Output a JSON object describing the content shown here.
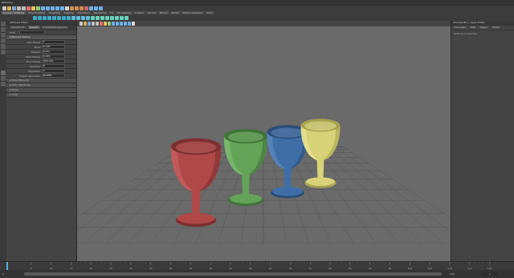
{
  "app": {
    "title": "Modeling"
  },
  "status_line": {
    "workspace": "Modeling",
    "tools": [
      {
        "icon": "new-scene-icon",
        "color": "#c9c9c9"
      },
      {
        "icon": "open-scene-icon",
        "color": "#d9b24c"
      },
      {
        "icon": "save-scene-icon",
        "color": "#7aa6d6"
      },
      {
        "icon": "undo-icon",
        "color": "#bdbdbd"
      },
      {
        "icon": "redo-icon",
        "color": "#bdbdbd"
      },
      {
        "icon": "select-hierarchy-icon",
        "color": "#ef6f6f"
      },
      {
        "icon": "select-object-icon",
        "color": "#e7c45a"
      },
      {
        "icon": "select-component-icon",
        "color": "#8fd17a"
      },
      {
        "icon": "snap-grid-icon",
        "color": "#6fb0e8"
      },
      {
        "icon": "snap-curve-icon",
        "color": "#6fb0e8"
      },
      {
        "icon": "snap-point-icon",
        "color": "#6fb0e8"
      },
      {
        "icon": "snap-view-icon",
        "color": "#6fb0e8"
      },
      {
        "icon": "snap-surface-icon",
        "color": "#6fb0e8"
      },
      {
        "icon": "construction-history-icon",
        "color": "#d9d9d9"
      },
      {
        "icon": "render-frame-icon",
        "color": "#d38f4f"
      },
      {
        "icon": "ipr-render-icon",
        "color": "#d38f4f"
      },
      {
        "icon": "render-settings-icon",
        "color": "#d38f4f"
      },
      {
        "icon": "hypershade-icon",
        "color": "#cf6b6b"
      },
      {
        "icon": "toggle-modeling-toolkit-icon",
        "color": "#6fb0e8"
      },
      {
        "icon": "toggle-attribute-editor-icon",
        "color": "#6fb0e8"
      },
      {
        "icon": "toggle-channel-box-icon",
        "color": "#6fb0e8"
      }
    ]
  },
  "shelf": {
    "tabs": [
      "Curves / Surfaces",
      "Poly Modeling",
      "Sculpting",
      "Rigging",
      "Animation",
      "Rendering",
      "FX",
      "FX Caching",
      "Custom",
      "Arnold",
      "Bifrost",
      "MASH",
      "Motion Graphics",
      "XGen"
    ],
    "active_tab": 0,
    "tools": [
      {
        "icon": "nurbs-sphere-icon",
        "color": "#3fa9c9"
      },
      {
        "icon": "nurbs-cube-icon",
        "color": "#3fa9c9"
      },
      {
        "icon": "nurbs-cylinder-icon",
        "color": "#3fa9c9"
      },
      {
        "icon": "nurbs-cone-icon",
        "color": "#3fa9c9"
      },
      {
        "icon": "nurbs-plane-icon",
        "color": "#3fa9c9"
      },
      {
        "icon": "nurbs-torus-icon",
        "color": "#3fa9c9"
      },
      {
        "icon": "nurbs-circle-icon",
        "color": "#3fa9c9"
      },
      {
        "icon": "nurbs-square-icon",
        "color": "#3fa9c9"
      },
      {
        "icon": "cv-curve-icon",
        "color": "#5fc0dc"
      },
      {
        "icon": "ep-curve-icon",
        "color": "#5fc0dc"
      },
      {
        "icon": "pencil-curve-icon",
        "color": "#5fc0dc"
      },
      {
        "icon": "arc-tool-icon",
        "color": "#5fc0dc"
      },
      {
        "icon": "revolve-icon",
        "color": "#6ad1b9"
      },
      {
        "icon": "loft-icon",
        "color": "#6ad1b9"
      },
      {
        "icon": "planar-icon",
        "color": "#6ad1b9"
      },
      {
        "icon": "extrude-icon",
        "color": "#6ad1b9"
      },
      {
        "icon": "birail-icon",
        "color": "#6ad1b9"
      },
      {
        "icon": "boundary-icon",
        "color": "#6ad1b9"
      },
      {
        "icon": "bevel-plus-icon",
        "color": "#6ad1b9"
      },
      {
        "icon": "offset-curve-icon",
        "color": "#6ad1b9"
      }
    ]
  },
  "attribute_editor": {
    "header": "Attribute Editor",
    "node_label": "bowl",
    "tabs": [
      "transform1",
      "shape1",
      "initialShadingGroup"
    ],
    "section": "Revolve History",
    "rows": [
      {
        "label": "Axis Preset",
        "value": "Y"
      },
      {
        "label": "Pivot",
        "value": "0.000"
      },
      {
        "label": "Degree",
        "value": "Cubic"
      },
      {
        "label": "Start Sweep",
        "value": "0.000"
      },
      {
        "label": "End Sweep",
        "value": "360.000"
      },
      {
        "label": "Sections",
        "value": "8"
      },
      {
        "label": "Segments",
        "value": "1"
      },
      {
        "label": "Output geometry",
        "value": "NURBS"
      }
    ],
    "collapsed_sections": [
      "Node Behavior",
      "Extra Attributes",
      "Notes",
      "UUID"
    ]
  },
  "viewport": {
    "background": "#6a6a6a",
    "grid_color": "#575757",
    "objects": [
      {
        "name": "red-goblet",
        "color": "#b04848",
        "shade": "#7e2f2f",
        "light": "#d06a6a"
      },
      {
        "name": "green-goblet",
        "color": "#63a458",
        "shade": "#3f7337",
        "light": "#88c47c"
      },
      {
        "name": "blue-goblet",
        "color": "#3f6ea7",
        "shade": "#2a4c78",
        "light": "#6692c6"
      },
      {
        "name": "yellow-goblet",
        "color": "#d8d378",
        "shade": "#a8a24f",
        "light": "#eeea9e"
      }
    ]
  },
  "right_panel": {
    "title": "Channel Box / Layer Editor",
    "menu": [
      "Channels",
      "Edit",
      "Object",
      "Show"
    ],
    "note": "Nothing is selected"
  },
  "timeline": {
    "start": "1",
    "end": "120",
    "current_frame": "1",
    "ticks": [
      "5",
      "10",
      "15",
      "20",
      "25",
      "30",
      "35",
      "40",
      "45",
      "50",
      "55",
      "60",
      "65",
      "70",
      "75",
      "80",
      "85",
      "90",
      "95",
      "100",
      "105",
      "110",
      "115",
      "120"
    ],
    "range_start": "1",
    "range_end": "120"
  }
}
